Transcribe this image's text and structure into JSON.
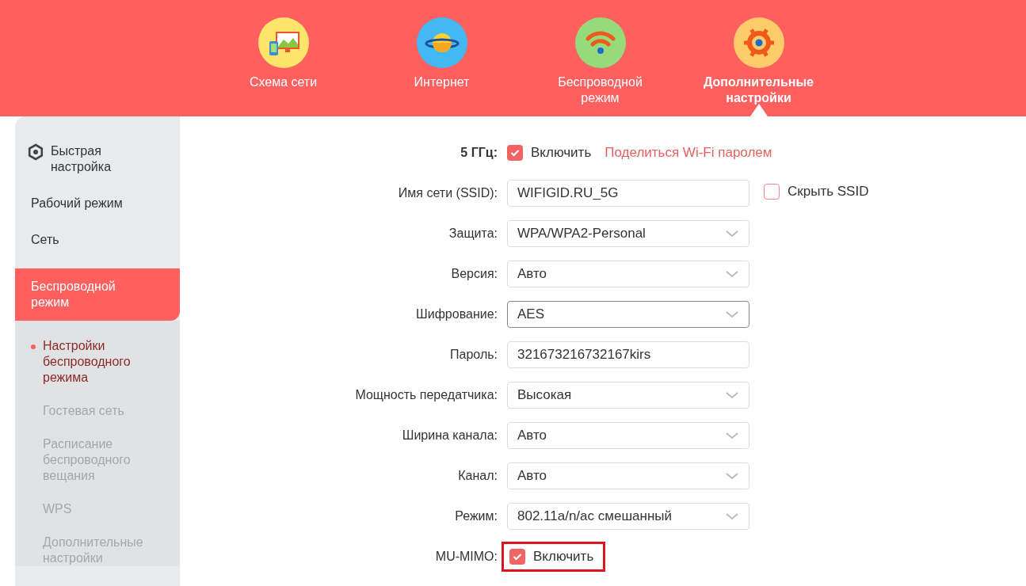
{
  "top_nav": [
    {
      "label": "Схема сети",
      "kind": "network-map",
      "selected": false
    },
    {
      "label": "Интернет",
      "kind": "internet",
      "selected": false
    },
    {
      "label": "Беспроводной режим",
      "kind": "wireless",
      "selected": false
    },
    {
      "label": "Дополнительные настройки",
      "kind": "advanced",
      "selected": true
    }
  ],
  "sidebar": {
    "items": [
      {
        "label": "Быстрая настройка",
        "kind": "quick-setup",
        "selected": false
      },
      {
        "label": "Рабочий режим",
        "kind": "menu",
        "selected": false
      },
      {
        "label": "Сеть",
        "kind": "menu",
        "selected": false
      },
      {
        "label": "Беспроводной режим",
        "kind": "menu",
        "selected": true,
        "children": [
          {
            "label": "Настройки беспроводного режима",
            "selected": true
          },
          {
            "label": "Гостевая сеть",
            "selected": false
          },
          {
            "label": "Расписание беспроводного вещания",
            "selected": false
          },
          {
            "label": "WPS",
            "selected": false
          },
          {
            "label": "Дополнительные настройки",
            "selected": false
          }
        ]
      }
    ]
  },
  "form": {
    "rows": [
      {
        "kind": "checkbox",
        "label": "5 ГГц:",
        "bold": true,
        "checked": true,
        "option": "Включить",
        "link": "Поделиться Wi-Fi паролем",
        "highlighted": false
      },
      {
        "kind": "text",
        "label": "Имя сети (SSID):",
        "value": "WIFIGID.RU_5G",
        "extra": {
          "label": "Скрыть SSID",
          "checked": false
        }
      },
      {
        "kind": "select",
        "label": "Защита:",
        "value": "WPA/WPA2-Personal",
        "focused": false
      },
      {
        "kind": "select",
        "label": "Версия:",
        "value": "Авто",
        "focused": false
      },
      {
        "kind": "select",
        "label": "Шифрование:",
        "value": "AES",
        "focused": true
      },
      {
        "kind": "text",
        "label": "Пароль:",
        "value": "321673216732167kirs"
      },
      {
        "kind": "select",
        "label": "Мощность передатчика:",
        "value": "Высокая",
        "focused": false
      },
      {
        "kind": "select",
        "label": "Ширина канала:",
        "value": "Авто",
        "focused": false
      },
      {
        "kind": "select",
        "label": "Канал:",
        "value": "Авто",
        "focused": false
      },
      {
        "kind": "select",
        "label": "Режим:",
        "value": "802.11a/n/ac смешанный",
        "focused": false
      },
      {
        "kind": "checkbox",
        "label": "MU-MIMO:",
        "bold": false,
        "checked": true,
        "option": "Включить",
        "highlighted": true
      }
    ]
  }
}
